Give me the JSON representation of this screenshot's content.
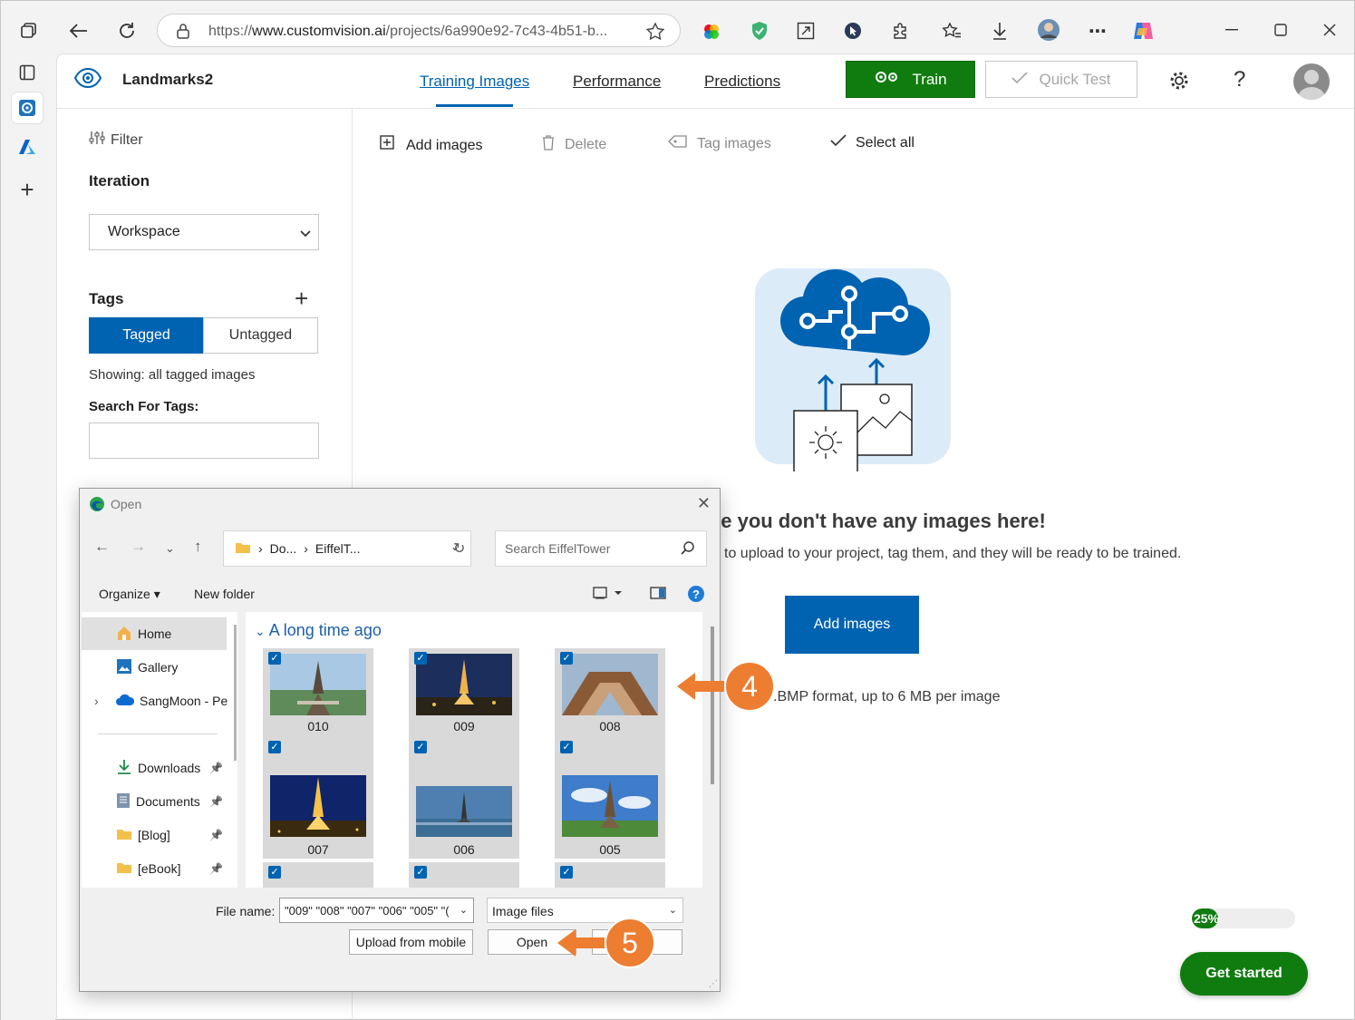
{
  "browser": {
    "url_prefix": "https://",
    "url_host": "www.customvision.ai",
    "url_path": "/projects/6a990e92-7c43-4b51-b..."
  },
  "app": {
    "project_name": "Landmarks2",
    "nav": [
      {
        "label": "Training Images",
        "active": true
      },
      {
        "label": "Performance",
        "active": false
      },
      {
        "label": "Predictions",
        "active": false
      }
    ],
    "train_label": "Train",
    "quick_test_label": "Quick Test",
    "help_label": "?"
  },
  "left_panel": {
    "filter_label": "Filter",
    "iteration_label": "Iteration",
    "iteration_value": "Workspace",
    "tags_label": "Tags",
    "seg_tagged": "Tagged",
    "seg_untagged": "Untagged",
    "showing": "Showing: all tagged images",
    "search_label": "Search For Tags:"
  },
  "toolbar": {
    "add_images": "Add images",
    "delete": "Delete",
    "tag_images": "Tag images",
    "select_all": "Select all"
  },
  "empty_state": {
    "title": "ke you don't have any images here!",
    "subtitle": "to upload to your project, tag them, and they will be ready to be trained.",
    "add_button": "Add images",
    "format_note": ".BMP format, up to 6 MB per image"
  },
  "progress": {
    "percent": 25,
    "label": "25%"
  },
  "get_started": "Get started",
  "dialog": {
    "title": "Open",
    "crumb_1": "Do...",
    "crumb_2": "EiffelT...",
    "search_placeholder": "Search EiffelTower",
    "organize": "Organize",
    "new_folder": "New folder",
    "nav_items": [
      {
        "label": "Home",
        "icon": "home-icon",
        "selected": true,
        "pinned": false
      },
      {
        "label": "Gallery",
        "icon": "gallery-icon",
        "selected": false,
        "pinned": false
      },
      {
        "label": "SangMoon - Pe",
        "icon": "onedrive-icon",
        "selected": false,
        "pinned": false
      },
      {
        "label": "Downloads",
        "icon": "download-folder-icon",
        "selected": false,
        "pinned": true
      },
      {
        "label": "Documents",
        "icon": "documents-icon",
        "selected": false,
        "pinned": true
      },
      {
        "label": "[Blog]",
        "icon": "folder-icon",
        "selected": false,
        "pinned": true
      },
      {
        "label": "[eBook]",
        "icon": "folder-icon",
        "selected": false,
        "pinned": true
      }
    ],
    "group_label": "A long time ago",
    "files": [
      {
        "name": "010",
        "checked": true
      },
      {
        "name": "009",
        "checked": true
      },
      {
        "name": "008",
        "checked": true
      },
      {
        "name": "007",
        "checked": true
      },
      {
        "name": "006",
        "checked": true
      },
      {
        "name": "005",
        "checked": true
      }
    ],
    "file_name_label": "File name:",
    "file_name_value": "\"009\" \"008\" \"007\" \"006\" \"005\" \"(",
    "file_type": "Image files",
    "upload_mobile": "Upload from mobile",
    "open": "Open",
    "cancel_partial": "el"
  },
  "callouts": [
    {
      "label": "4"
    },
    {
      "label": "5"
    }
  ],
  "colors": {
    "accent": "#0063b1",
    "train_green": "#107c10",
    "callout_orange": "#ed7d31"
  }
}
